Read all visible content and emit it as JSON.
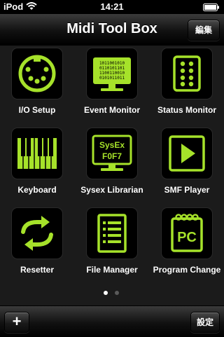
{
  "status_bar": {
    "carrier": "iPod",
    "time": "14:21"
  },
  "nav_bar": {
    "title": "Midi Tool Box",
    "edit_button": "編集"
  },
  "accent_color": "#a6e22a",
  "tiles": [
    {
      "label": "I/O Setup",
      "icon": "midi-din-connector-icon"
    },
    {
      "label": "Event Monitor",
      "icon": "binary-monitor-icon"
    },
    {
      "label": "Status Monitor",
      "icon": "led-status-panel-icon"
    },
    {
      "label": "Keyboard",
      "icon": "piano-keyboard-icon"
    },
    {
      "label": "Sysex Librarian",
      "icon": "sysex-monitor-icon",
      "icon_text": [
        "SysEx",
        "F0F7"
      ]
    },
    {
      "label": "SMF Player",
      "icon": "play-icon"
    },
    {
      "label": "Resetter",
      "icon": "refresh-arrows-icon"
    },
    {
      "label": "File Manager",
      "icon": "file-list-icon"
    },
    {
      "label": "Program Change",
      "icon": "pc-notepad-icon",
      "icon_text": [
        "PC"
      ]
    }
  ],
  "page_control": {
    "pages": 2,
    "current": 1
  },
  "toolbar": {
    "add_button": "+",
    "settings_button": "設定"
  }
}
